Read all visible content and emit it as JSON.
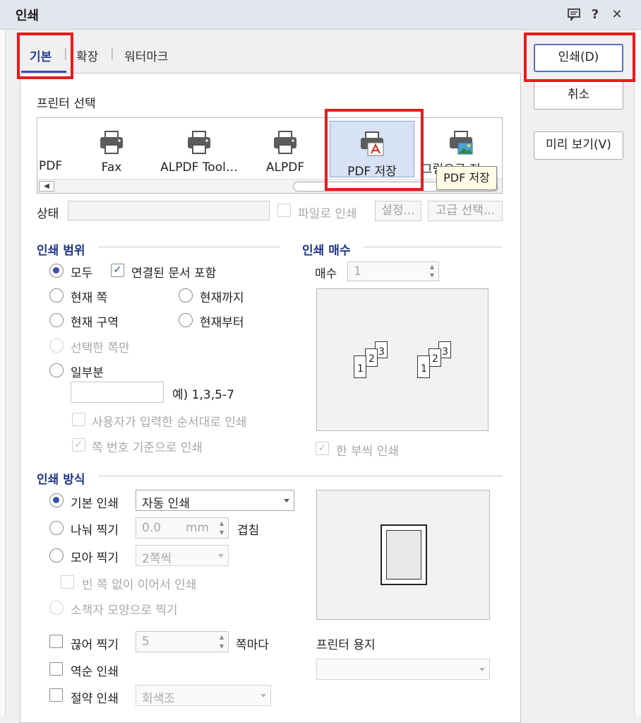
{
  "dialog": {
    "title": "인쇄"
  },
  "titlebar_icons": [
    "comment-icon",
    "help-icon",
    "close-icon"
  ],
  "titlebar_glyphs": {
    "help": "?",
    "close": "✕"
  },
  "tabs": [
    {
      "label": "기본",
      "active": true
    },
    {
      "label": "확장",
      "active": false
    },
    {
      "label": "워터마크",
      "active": false
    }
  ],
  "tab_separator": "|",
  "actions": {
    "print_label": "인쇄(D)",
    "cancel_label": "취소",
    "preview_label": "미리 보기(V)"
  },
  "printer_select": {
    "title": "프린터 선택",
    "printers": [
      {
        "label": "PDF",
        "icon": "printer-icon"
      },
      {
        "label": "Fax",
        "icon": "printer-icon"
      },
      {
        "label": "ALPDF Tool…",
        "icon": "printer-icon"
      },
      {
        "label": "ALPDF",
        "icon": "printer-icon"
      },
      {
        "label": "PDF 저장",
        "icon": "pdf-printer-icon",
        "selected": true
      },
      {
        "label": "그림으로 저…",
        "icon": "image-printer-icon"
      }
    ],
    "tooltip": "PDF 저장",
    "scroll_left_glyph": "◀"
  },
  "status": {
    "label": "상태",
    "value": "",
    "print_to_file_label": "파일로 인쇄",
    "settings_label": "설정...",
    "advanced_label": "고급 선택..."
  },
  "print_range": {
    "title": "인쇄 범위",
    "options": {
      "all": "모두",
      "include_linked": "연결된 문서 포함",
      "current_page": "현재 쪽",
      "up_to_current": "현재까지",
      "current_section": "현재 구역",
      "from_current": "현재부터",
      "selected_only": "선택한 쪽만",
      "partial": "일부분"
    },
    "partial_value": "",
    "partial_example": "예) 1,3,5-7",
    "user_order_label": "사용자가 입력한 순서대로 인쇄",
    "page_number_basis_label": "쪽 번호 기준으로 인쇄"
  },
  "copies": {
    "title": "인쇄 매수",
    "label": "매수",
    "value": "1",
    "collate_label": "한 부씩 인쇄",
    "page_numbers": [
      "1",
      "2",
      "3"
    ]
  },
  "print_method": {
    "title": "인쇄 방식",
    "basic_label": "기본 인쇄",
    "basic_value": "자동 인쇄",
    "split_label": "나눠 찍기",
    "split_value": "0.0",
    "split_unit": "mm",
    "overlap_label": "겹침",
    "gather_label": "모아 찍기",
    "gather_value": "2쪽씩",
    "no_blank_label": "빈 쪽 없이 이어서 인쇄",
    "booklet_label": "소책자 모양으로 찍기",
    "cut_label": "끊어 찍기",
    "cut_value": "5",
    "per_page_label": "쪽마다",
    "reverse_label": "역순 인쇄",
    "economy_label": "절약 인쇄",
    "economy_value": "회색조",
    "paper_label": "프린터 용지",
    "paper_value": ""
  },
  "colors": {
    "accent": "#2a3f9a",
    "highlight": "#ea1a1a",
    "selection": "#d8e2f5"
  }
}
